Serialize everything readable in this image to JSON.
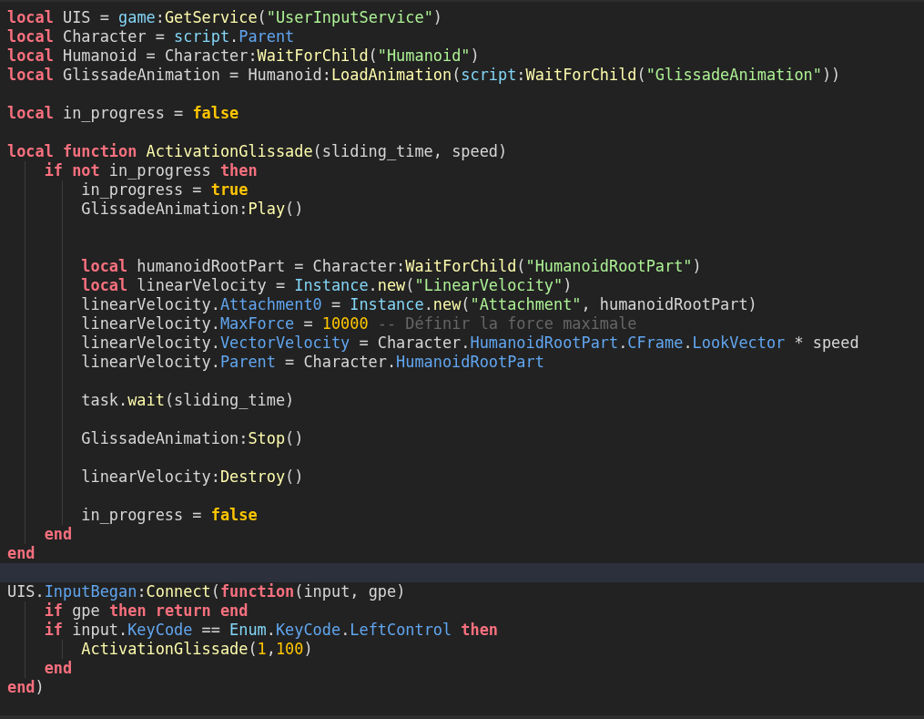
{
  "editor": {
    "lines": [
      {
        "kind": "code",
        "current": false,
        "tokens": [
          {
            "kind": "keyword",
            "text": "local"
          },
          {
            "kind": "plain",
            "text": " UIS = "
          },
          {
            "kind": "builtin",
            "text": "game"
          },
          {
            "kind": "plain",
            "text": ":"
          },
          {
            "kind": "function",
            "text": "GetService"
          },
          {
            "kind": "plain",
            "text": "("
          },
          {
            "kind": "string",
            "text": "\"UserInputService\""
          },
          {
            "kind": "plain",
            "text": ")"
          }
        ]
      },
      {
        "kind": "code",
        "current": false,
        "tokens": [
          {
            "kind": "keyword",
            "text": "local"
          },
          {
            "kind": "plain",
            "text": " Character = "
          },
          {
            "kind": "builtin",
            "text": "script"
          },
          {
            "kind": "plain",
            "text": "."
          },
          {
            "kind": "property",
            "text": "Parent"
          }
        ]
      },
      {
        "kind": "code",
        "current": false,
        "tokens": [
          {
            "kind": "keyword",
            "text": "local"
          },
          {
            "kind": "plain",
            "text": " Humanoid = Character:"
          },
          {
            "kind": "function",
            "text": "WaitForChild"
          },
          {
            "kind": "plain",
            "text": "("
          },
          {
            "kind": "string",
            "text": "\"Humanoid\""
          },
          {
            "kind": "plain",
            "text": ")"
          }
        ]
      },
      {
        "kind": "code",
        "current": false,
        "tokens": [
          {
            "kind": "keyword",
            "text": "local"
          },
          {
            "kind": "plain",
            "text": " GlissadeAnimation = Humanoid:"
          },
          {
            "kind": "function",
            "text": "LoadAnimation"
          },
          {
            "kind": "plain",
            "text": "("
          },
          {
            "kind": "builtin",
            "text": "script"
          },
          {
            "kind": "plain",
            "text": ":"
          },
          {
            "kind": "function",
            "text": "WaitForChild"
          },
          {
            "kind": "plain",
            "text": "("
          },
          {
            "kind": "string",
            "text": "\"GlissadeAnimation\""
          },
          {
            "kind": "plain",
            "text": "))"
          }
        ]
      },
      {
        "kind": "blank",
        "current": false
      },
      {
        "kind": "code",
        "current": false,
        "tokens": [
          {
            "kind": "keyword",
            "text": "local"
          },
          {
            "kind": "plain",
            "text": " in_progress = "
          },
          {
            "kind": "boolean",
            "text": "false"
          }
        ]
      },
      {
        "kind": "blank",
        "current": false
      },
      {
        "kind": "code",
        "current": false,
        "tokens": [
          {
            "kind": "keyword",
            "text": "local function"
          },
          {
            "kind": "function",
            "text": " ActivationGlissade"
          },
          {
            "kind": "plain",
            "text": "(sliding_time, speed)"
          }
        ],
        "children": [
          {
            "kind": "code",
            "current": false,
            "tokens": [
              {
                "kind": "keyword",
                "text": "if not"
              },
              {
                "kind": "plain",
                "text": " in_progress "
              },
              {
                "kind": "keyword",
                "text": "then"
              }
            ],
            "children": [
              {
                "kind": "code",
                "current": false,
                "tokens": [
                  {
                    "kind": "plain",
                    "text": "in_progress = "
                  },
                  {
                    "kind": "boolean",
                    "text": "true"
                  }
                ]
              },
              {
                "kind": "code",
                "current": false,
                "tokens": [
                  {
                    "kind": "plain",
                    "text": "GlissadeAnimation:"
                  },
                  {
                    "kind": "function",
                    "text": "Play"
                  },
                  {
                    "kind": "plain",
                    "text": "()"
                  }
                ]
              },
              {
                "kind": "blank",
                "current": false
              },
              {
                "kind": "blank",
                "current": false
              },
              {
                "kind": "code",
                "current": false,
                "tokens": [
                  {
                    "kind": "keyword",
                    "text": "local"
                  },
                  {
                    "kind": "plain",
                    "text": " humanoidRootPart = Character:"
                  },
                  {
                    "kind": "function",
                    "text": "WaitForChild"
                  },
                  {
                    "kind": "plain",
                    "text": "("
                  },
                  {
                    "kind": "string",
                    "text": "\"HumanoidRootPart\""
                  },
                  {
                    "kind": "plain",
                    "text": ")"
                  }
                ]
              },
              {
                "kind": "code",
                "current": false,
                "tokens": [
                  {
                    "kind": "keyword",
                    "text": "local"
                  },
                  {
                    "kind": "plain",
                    "text": " linearVelocity = "
                  },
                  {
                    "kind": "builtin",
                    "text": "Instance"
                  },
                  {
                    "kind": "plain",
                    "text": "."
                  },
                  {
                    "kind": "function",
                    "text": "new"
                  },
                  {
                    "kind": "plain",
                    "text": "("
                  },
                  {
                    "kind": "string",
                    "text": "\"LinearVelocity\""
                  },
                  {
                    "kind": "plain",
                    "text": ")"
                  }
                ]
              },
              {
                "kind": "code",
                "current": false,
                "tokens": [
                  {
                    "kind": "plain",
                    "text": "linearVelocity."
                  },
                  {
                    "kind": "property",
                    "text": "Attachment0"
                  },
                  {
                    "kind": "plain",
                    "text": " = "
                  },
                  {
                    "kind": "builtin",
                    "text": "Instance"
                  },
                  {
                    "kind": "plain",
                    "text": "."
                  },
                  {
                    "kind": "function",
                    "text": "new"
                  },
                  {
                    "kind": "plain",
                    "text": "("
                  },
                  {
                    "kind": "string",
                    "text": "\"Attachment\""
                  },
                  {
                    "kind": "plain",
                    "text": ", humanoidRootPart)"
                  }
                ]
              },
              {
                "kind": "code",
                "current": false,
                "tokens": [
                  {
                    "kind": "plain",
                    "text": "linearVelocity."
                  },
                  {
                    "kind": "property",
                    "text": "MaxForce"
                  },
                  {
                    "kind": "plain",
                    "text": " = "
                  },
                  {
                    "kind": "number",
                    "text": "10000"
                  },
                  {
                    "kind": "comment",
                    "text": " -- Définir la force maximale"
                  }
                ]
              },
              {
                "kind": "code",
                "current": false,
                "tokens": [
                  {
                    "kind": "plain",
                    "text": "linearVelocity."
                  },
                  {
                    "kind": "property",
                    "text": "VectorVelocity"
                  },
                  {
                    "kind": "plain",
                    "text": " = Character."
                  },
                  {
                    "kind": "property",
                    "text": "HumanoidRootPart"
                  },
                  {
                    "kind": "plain",
                    "text": "."
                  },
                  {
                    "kind": "property",
                    "text": "CFrame"
                  },
                  {
                    "kind": "plain",
                    "text": "."
                  },
                  {
                    "kind": "property",
                    "text": "LookVector"
                  },
                  {
                    "kind": "plain",
                    "text": " * speed"
                  }
                ]
              },
              {
                "kind": "code",
                "current": false,
                "tokens": [
                  {
                    "kind": "plain",
                    "text": "linearVelocity."
                  },
                  {
                    "kind": "property",
                    "text": "Parent"
                  },
                  {
                    "kind": "plain",
                    "text": " = Character."
                  },
                  {
                    "kind": "property",
                    "text": "HumanoidRootPart"
                  }
                ]
              },
              {
                "kind": "blank",
                "current": false
              },
              {
                "kind": "code",
                "current": false,
                "tokens": [
                  {
                    "kind": "plain",
                    "text": "task."
                  },
                  {
                    "kind": "function",
                    "text": "wait"
                  },
                  {
                    "kind": "plain",
                    "text": "(sliding_time)"
                  }
                ]
              },
              {
                "kind": "blank",
                "current": false
              },
              {
                "kind": "code",
                "current": false,
                "tokens": [
                  {
                    "kind": "plain",
                    "text": "GlissadeAnimation:"
                  },
                  {
                    "kind": "function",
                    "text": "Stop"
                  },
                  {
                    "kind": "plain",
                    "text": "()"
                  }
                ]
              },
              {
                "kind": "blank",
                "current": false
              },
              {
                "kind": "code",
                "current": false,
                "tokens": [
                  {
                    "kind": "plain",
                    "text": "linearVelocity:"
                  },
                  {
                    "kind": "function",
                    "text": "Destroy"
                  },
                  {
                    "kind": "plain",
                    "text": "()"
                  }
                ]
              },
              {
                "kind": "blank",
                "current": false
              },
              {
                "kind": "code",
                "current": false,
                "tokens": [
                  {
                    "kind": "plain",
                    "text": "in_progress = "
                  },
                  {
                    "kind": "boolean",
                    "text": "false"
                  }
                ]
              }
            ]
          },
          {
            "kind": "code",
            "current": false,
            "tokens": [
              {
                "kind": "keyword",
                "text": "end"
              }
            ]
          }
        ]
      },
      {
        "kind": "code",
        "current": false,
        "tokens": [
          {
            "kind": "keyword",
            "text": "end"
          }
        ]
      },
      {
        "kind": "blank",
        "current": true
      },
      {
        "kind": "code",
        "current": false,
        "tokens": [
          {
            "kind": "plain",
            "text": "UIS."
          },
          {
            "kind": "property",
            "text": "InputBegan"
          },
          {
            "kind": "plain",
            "text": ":"
          },
          {
            "kind": "function",
            "text": "Connect"
          },
          {
            "kind": "plain",
            "text": "("
          },
          {
            "kind": "keyword",
            "text": "function"
          },
          {
            "kind": "plain",
            "text": "(input, gpe)"
          }
        ],
        "children": [
          {
            "kind": "code",
            "current": false,
            "tokens": [
              {
                "kind": "keyword",
                "text": "if"
              },
              {
                "kind": "plain",
                "text": " gpe "
              },
              {
                "kind": "keyword",
                "text": "then return end"
              }
            ]
          },
          {
            "kind": "code",
            "current": false,
            "tokens": [
              {
                "kind": "keyword",
                "text": "if"
              },
              {
                "kind": "plain",
                "text": " input."
              },
              {
                "kind": "property",
                "text": "KeyCode"
              },
              {
                "kind": "plain",
                "text": " == "
              },
              {
                "kind": "builtin",
                "text": "Enum"
              },
              {
                "kind": "plain",
                "text": "."
              },
              {
                "kind": "property",
                "text": "KeyCode"
              },
              {
                "kind": "plain",
                "text": "."
              },
              {
                "kind": "property",
                "text": "LeftControl"
              },
              {
                "kind": "keyword",
                "text": " then"
              }
            ],
            "children": [
              {
                "kind": "code",
                "current": false,
                "tokens": [
                  {
                    "kind": "function",
                    "text": "ActivationGlissade"
                  },
                  {
                    "kind": "plain",
                    "text": "("
                  },
                  {
                    "kind": "number",
                    "text": "1"
                  },
                  {
                    "kind": "plain",
                    "text": ","
                  },
                  {
                    "kind": "number",
                    "text": "100"
                  },
                  {
                    "kind": "plain",
                    "text": ")"
                  }
                ]
              }
            ]
          },
          {
            "kind": "code",
            "current": false,
            "tokens": [
              {
                "kind": "keyword",
                "text": "end"
              }
            ]
          }
        ]
      },
      {
        "kind": "code",
        "current": false,
        "tokens": [
          {
            "kind": "keyword",
            "text": "end"
          },
          {
            "kind": "plain",
            "text": ")"
          }
        ]
      }
    ]
  }
}
